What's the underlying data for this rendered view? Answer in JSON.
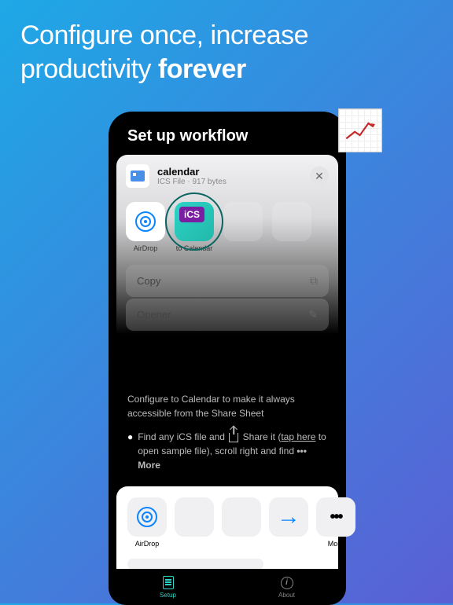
{
  "headline": {
    "part1": "Configure once, increase productivity ",
    "part2": "forever"
  },
  "phone": {
    "title": "Set up workflow"
  },
  "file": {
    "name": "calendar",
    "meta": "ICS File · 917 bytes"
  },
  "share": {
    "airdrop": "AirDrop",
    "to_calendar": "to Calendar",
    "ics_badge": "iCS"
  },
  "actions": {
    "copy": "Copy",
    "opener": "Opener"
  },
  "instructions": {
    "configure": "Configure to Calendar to make it always accessible from the Share Sheet",
    "step1_a": "Find any iCS file and ",
    "step1_b": " Share it (",
    "step1_link": "tap here",
    "step1_c": " to open sample file), scroll right and find ",
    "step1_more": "••• More"
  },
  "bottom": {
    "airdrop": "AirDrop",
    "more": "More"
  },
  "tabs": {
    "setup": "Setup",
    "about": "About"
  }
}
